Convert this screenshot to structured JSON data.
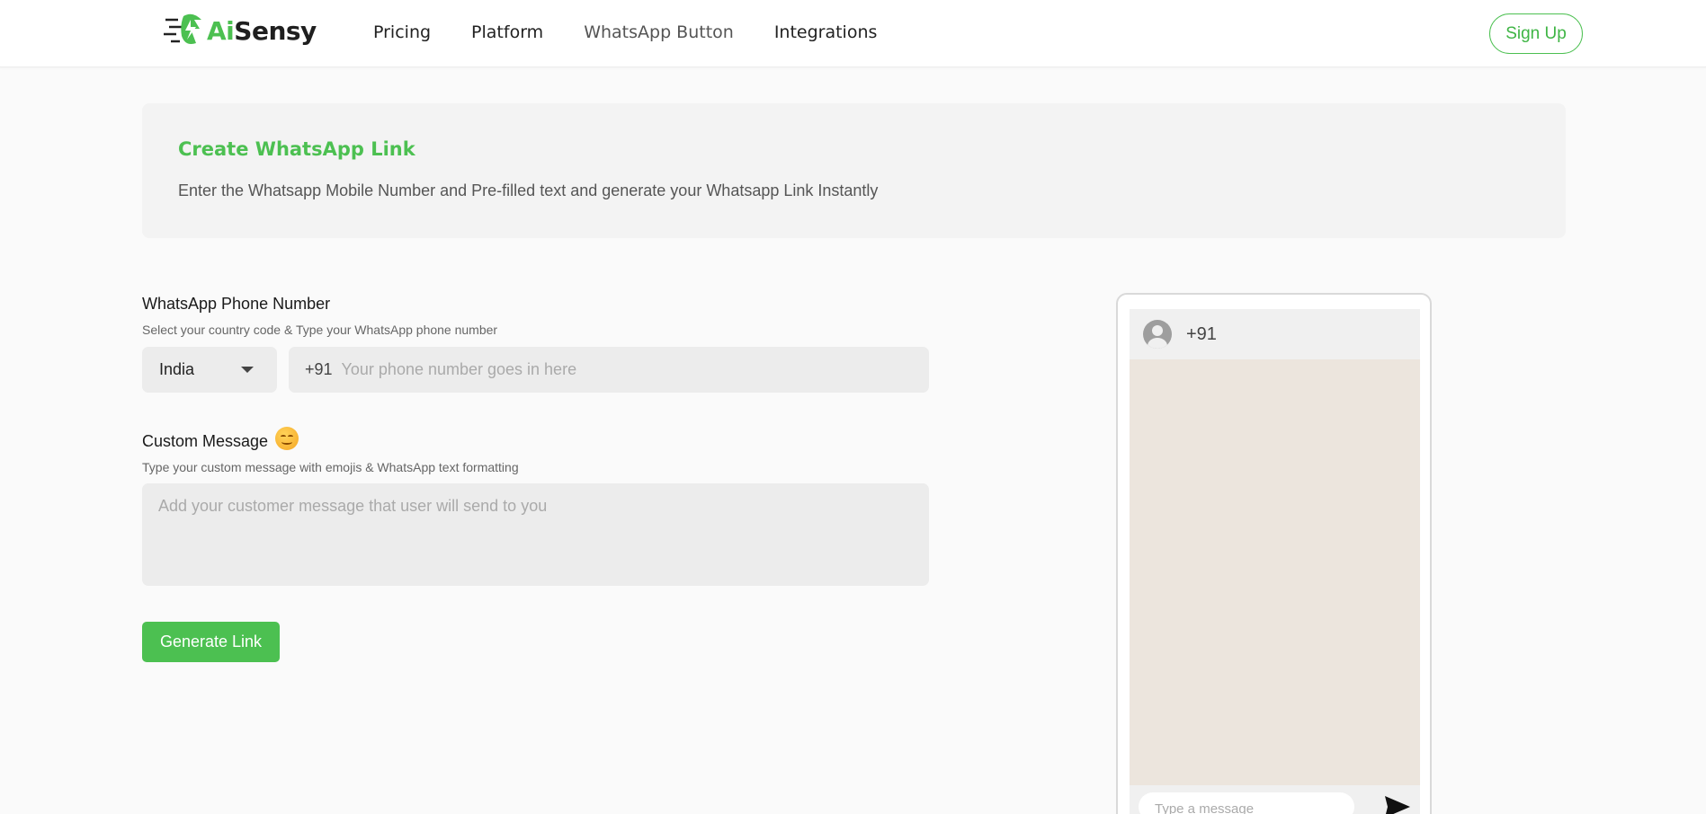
{
  "header": {
    "logo": {
      "part1": "Ai",
      "part2": "Sensy"
    },
    "nav": [
      {
        "label": "Pricing"
      },
      {
        "label": "Platform"
      },
      {
        "label": "WhatsApp Button"
      },
      {
        "label": "Integrations"
      }
    ],
    "signup_label": "Sign Up"
  },
  "banner": {
    "title": "Create WhatsApp Link",
    "subtitle": "Enter the Whatsapp Mobile Number and Pre-filled text and generate your Whatsapp Link Instantly"
  },
  "form": {
    "phone_label": "WhatsApp Phone Number",
    "phone_hint": "Select your country code & Type your WhatsApp phone number",
    "country_value": "India",
    "country_code": "+91",
    "phone_value": "",
    "phone_placeholder": "Your phone number goes in here",
    "message_label": "Custom Message",
    "message_hint": "Type your custom message with emojis & WhatsApp text formatting",
    "message_value": "",
    "message_placeholder": "Add your customer message that user will send to you",
    "generate_label": "Generate Link"
  },
  "preview": {
    "contact_number": "+91",
    "input_placeholder": "Type a message"
  },
  "colors": {
    "brand_green": "#4cc051",
    "chat_bg": "#ece5dd",
    "field_bg": "#ececec"
  },
  "icons": [
    "logo-icon",
    "chevron-down-icon",
    "smiley-emoji-icon",
    "avatar-icon",
    "send-icon"
  ]
}
